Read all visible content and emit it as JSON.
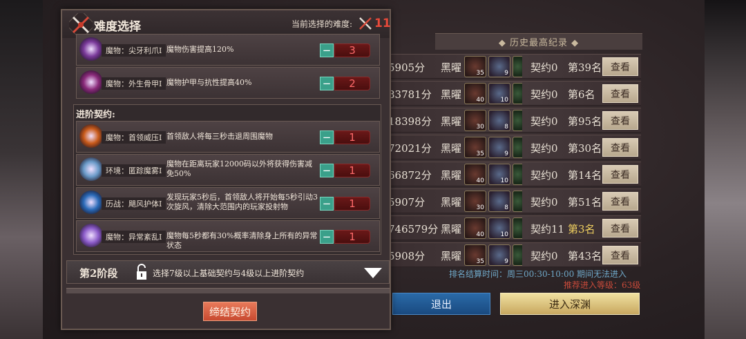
{
  "dialog": {
    "title": "难度选择",
    "current_label": "当前选择的难度:",
    "current_value": "11",
    "advanced_title": "进阶契约:",
    "basic_modifiers": [
      {
        "name": "魔物：尖牙利爪Ⅰ",
        "desc": "魔物伤害提高120%",
        "level": "3",
        "icon_color": "#7a3a9a"
      },
      {
        "name": "魔物：外生骨甲Ⅰ",
        "desc": "魔物护甲与抗性提高40%",
        "level": "2",
        "icon_color": "#8a2a7a"
      }
    ],
    "advanced_modifiers": [
      {
        "name": "魔物：首领威压Ⅰ",
        "desc": "首领敌人将每三秒击退周围魔物",
        "level": "1",
        "icon_color": "#c85a1a"
      },
      {
        "name": "环境：匿踪魔雾Ⅰ",
        "desc": "魔物在距离玩家12000码以外将获得伤害减免50%",
        "level": "1",
        "icon_color": "#6a9ac8"
      },
      {
        "name": "历战：飓风护体Ⅰ",
        "desc": "发现玩家5秒后，首领敌人将开始每5秒引动3次旋风，清除大范围内的玩家投射物",
        "level": "1",
        "icon_color": "#2a6ab8"
      },
      {
        "name": "魔物：异常紊乱Ⅰ",
        "desc": "魔物每5秒都有30%概率清除身上所有的异常状态",
        "level": "1",
        "icon_color": "#8a5ac8"
      }
    ],
    "minus_label": "−",
    "stage": {
      "title": "第2阶段",
      "desc": "选择7级以上基础契约与4级以上进阶契约"
    },
    "conclude_label": "缔结契约"
  },
  "leaderboard": {
    "header": "◆ 历史最高纪录 ◆",
    "rows": [
      {
        "score": "5905分",
        "mode": "黑曜",
        "n1": "35",
        "n2": "9",
        "contract": "契约0",
        "place": "第39名",
        "gold": false
      },
      {
        "score": "83781分",
        "mode": "黑曜",
        "n1": "40",
        "n2": "10",
        "contract": "契约0",
        "place": "第6名",
        "gold": false
      },
      {
        "score": "18398分",
        "mode": "黑曜",
        "n1": "30",
        "n2": "8",
        "contract": "契约0",
        "place": "第95名",
        "gold": false
      },
      {
        "score": "72021分",
        "mode": "黑曜",
        "n1": "35",
        "n2": "9",
        "contract": "契约0",
        "place": "第30名",
        "gold": false
      },
      {
        "score": "66872分",
        "mode": "黑曜",
        "n1": "40",
        "n2": "10",
        "contract": "契约0",
        "place": "第14名",
        "gold": false
      },
      {
        "score": "5907分",
        "mode": "黑曜",
        "n1": "30",
        "n2": "8",
        "contract": "契约0",
        "place": "第51名",
        "gold": false
      },
      {
        "score": "746579分",
        "mode": "黑曜",
        "n1": "40",
        "n2": "10",
        "contract": "契约11",
        "place": "第3名",
        "gold": true
      },
      {
        "score": "5908分",
        "mode": "黑曜",
        "n1": "35",
        "n2": "9",
        "contract": "契约0",
        "place": "第43名",
        "gold": false
      }
    ],
    "view_label": "查看",
    "settle_info": "排名结算时间：周三00:30-10:00 期间无法进入",
    "recommend_info": "推荐进入等级：63级",
    "exit_label": "退出",
    "enter_label": "进入深渊"
  }
}
